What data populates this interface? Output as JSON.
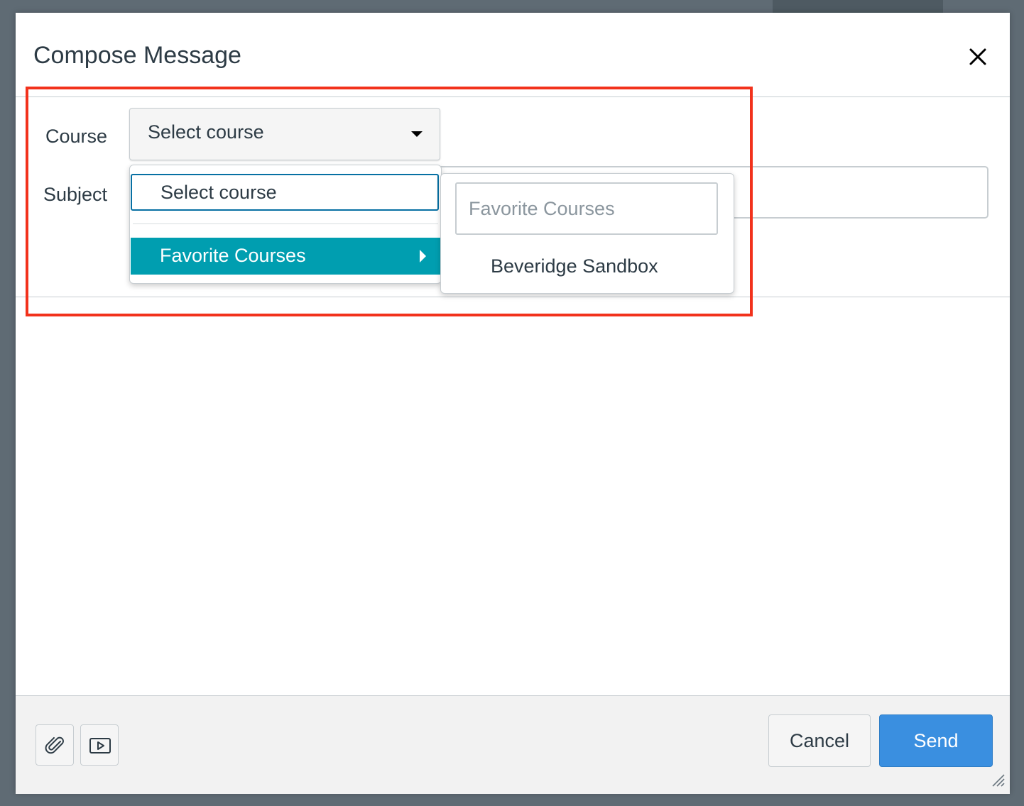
{
  "dialog": {
    "title": "Compose Message",
    "close_icon": "close-icon"
  },
  "form": {
    "course_label": "Course",
    "course_select_value": "Select course",
    "subject_label": "Subject"
  },
  "course_menu": {
    "items": [
      {
        "label": "Select course",
        "state": "focused"
      },
      {
        "label": "Favorite Courses",
        "state": "active",
        "has_submenu": true
      }
    ]
  },
  "submenu": {
    "header": "Favorite Courses",
    "items": [
      {
        "label": "Beveridge Sandbox"
      }
    ]
  },
  "footer": {
    "attach_icon": "paperclip-icon",
    "media_icon": "media-icon",
    "cancel_label": "Cancel",
    "send_label": "Send"
  },
  "colors": {
    "accent_active": "#009eb0",
    "focus_border": "#0770a3",
    "send_button": "#3a8fe0",
    "highlight": "#f2321c",
    "text": "#2d3b45"
  }
}
